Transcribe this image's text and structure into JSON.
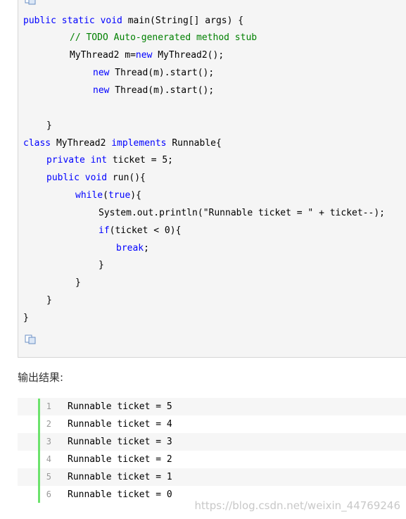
{
  "code_lines": [
    [
      {
        "t": "kw",
        "s": "public static void "
      },
      {
        "t": "txt",
        "s": "main(String[] args) {"
      }
    ],
    [
      {
        "t": "cm",
        "s": "// TODO Auto-generated method stub"
      }
    ],
    [
      {
        "t": "txt",
        "s": "MyThread2 m="
      },
      {
        "t": "kw",
        "s": "new"
      },
      {
        "t": "txt",
        "s": " MyThread2();"
      }
    ],
    [
      {
        "t": "kw",
        "s": "new"
      },
      {
        "t": "txt",
        "s": " Thread(m).start();"
      }
    ],
    [
      {
        "t": "kw",
        "s": "new"
      },
      {
        "t": "txt",
        "s": " Thread(m).start();"
      }
    ],
    [
      {
        "t": "txt",
        "s": "}"
      }
    ],
    [
      {
        "t": "kw",
        "s": "class"
      },
      {
        "t": "txt",
        "s": " MyThread2 "
      },
      {
        "t": "kw",
        "s": "implements"
      },
      {
        "t": "txt",
        "s": " Runnable{"
      }
    ],
    [
      {
        "t": "kw",
        "s": "private int"
      },
      {
        "t": "txt",
        "s": " ticket = 5;"
      }
    ],
    [
      {
        "t": "kw",
        "s": "public void"
      },
      {
        "t": "txt",
        "s": " run(){"
      }
    ],
    [
      {
        "t": "kw",
        "s": "while"
      },
      {
        "t": "txt",
        "s": "("
      },
      {
        "t": "kw",
        "s": "true"
      },
      {
        "t": "txt",
        "s": "){"
      }
    ],
    [
      {
        "t": "txt",
        "s": "System.out.println(\"Runnable ticket = \" + ticket--);"
      }
    ],
    [
      {
        "t": "kw",
        "s": "if"
      },
      {
        "t": "txt",
        "s": "(ticket < 0){"
      }
    ],
    [
      {
        "t": "kw",
        "s": "break"
      },
      {
        "t": "txt",
        "s": ";"
      }
    ],
    [
      {
        "t": "txt",
        "s": "}"
      }
    ],
    [
      {
        "t": "txt",
        "s": "}"
      }
    ],
    [
      {
        "t": "txt",
        "s": "}"
      }
    ],
    [
      {
        "t": "txt",
        "s": "}"
      }
    ]
  ],
  "output_heading": "输出结果:",
  "output_lines": [
    {
      "num": "1",
      "text": "Runnable ticket = 5"
    },
    {
      "num": "2",
      "text": "Runnable ticket = 4"
    },
    {
      "num": "3",
      "text": "Runnable ticket = 3"
    },
    {
      "num": "4",
      "text": "Runnable ticket = 2"
    },
    {
      "num": "5",
      "text": "Runnable ticket = 1"
    },
    {
      "num": "6",
      "text": "Runnable ticket = 0"
    }
  ],
  "watermark": "https://blog.csdn.net/weixin_44769246",
  "icons": {
    "copy": "copy-code-icon"
  },
  "colors": {
    "keyword": "#0000ff",
    "comment": "#008000",
    "accent_bar": "#6ce26c"
  }
}
